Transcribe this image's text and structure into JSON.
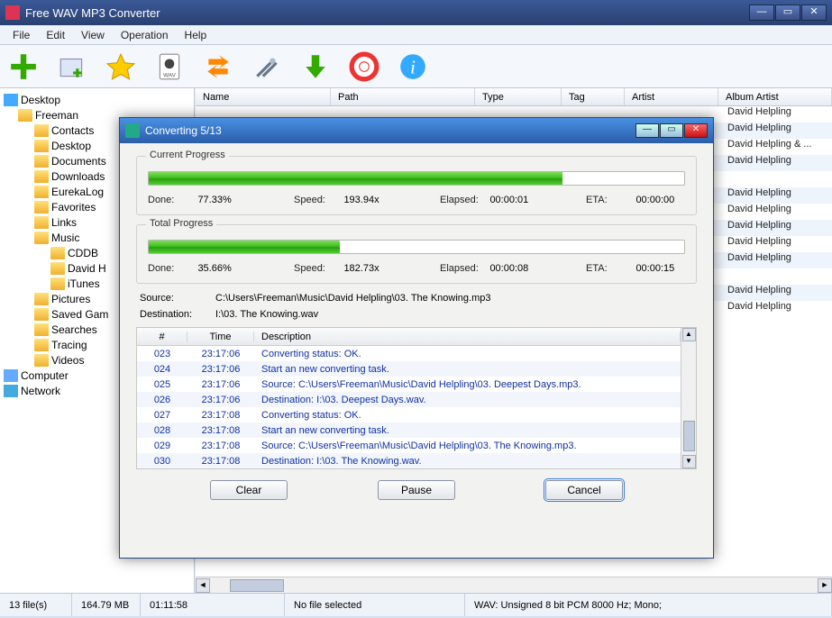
{
  "window": {
    "title": "Free WAV MP3 Converter",
    "menu": [
      "File",
      "Edit",
      "View",
      "Operation",
      "Help"
    ]
  },
  "toolbar_icons": [
    "add-file",
    "add-folder",
    "favorite",
    "output-format",
    "convert",
    "settings",
    "download",
    "help-life",
    "info"
  ],
  "tree": [
    {
      "label": "Desktop",
      "depth": 0,
      "icon": "monitor"
    },
    {
      "label": "Freeman",
      "depth": 1,
      "icon": "folder"
    },
    {
      "label": "Contacts",
      "depth": 2,
      "icon": "folder"
    },
    {
      "label": "Desktop",
      "depth": 2,
      "icon": "folder"
    },
    {
      "label": "Documents",
      "depth": 2,
      "icon": "folder"
    },
    {
      "label": "Downloads",
      "depth": 2,
      "icon": "folder"
    },
    {
      "label": "EurekaLog",
      "depth": 2,
      "icon": "folder"
    },
    {
      "label": "Favorites",
      "depth": 2,
      "icon": "folder"
    },
    {
      "label": "Links",
      "depth": 2,
      "icon": "folder"
    },
    {
      "label": "Music",
      "depth": 2,
      "icon": "folder"
    },
    {
      "label": "CDDB",
      "depth": 3,
      "icon": "folder"
    },
    {
      "label": "David H",
      "depth": 3,
      "icon": "folder"
    },
    {
      "label": "iTunes",
      "depth": 3,
      "icon": "folder"
    },
    {
      "label": "Pictures",
      "depth": 2,
      "icon": "folder"
    },
    {
      "label": "Saved Gam",
      "depth": 2,
      "icon": "folder"
    },
    {
      "label": "Searches",
      "depth": 2,
      "icon": "folder"
    },
    {
      "label": "Tracing",
      "depth": 2,
      "icon": "folder"
    },
    {
      "label": "Videos",
      "depth": 2,
      "icon": "folder"
    },
    {
      "label": "Computer",
      "depth": 0,
      "icon": "computer"
    },
    {
      "label": "Network",
      "depth": 0,
      "icon": "network"
    }
  ],
  "list": {
    "headers": [
      "Name",
      "Path",
      "Type",
      "Tag",
      "Artist",
      "Album Artist"
    ],
    "artist_rows": [
      "David Helpling",
      "David Helpling",
      "David Helpling & ...",
      "David Helpling",
      "",
      "David Helpling",
      "David Helpling",
      "David Helpling",
      "David Helpling",
      "David Helpling",
      "",
      "David Helpling",
      "David Helpling"
    ]
  },
  "status": {
    "files": "13 file(s)",
    "size": "164.79 MB",
    "dur": "01:11:58",
    "sel": "No file selected",
    "fmt": "WAV:   Unsigned 8 bit PCM  8000 Hz;  Mono;"
  },
  "dialog": {
    "title": "Converting 5/13",
    "current": {
      "label": "Current Progress",
      "pct": "77.33%",
      "pct_num": 77.33,
      "speed": "193.94x",
      "elapsed": "00:00:01",
      "eta": "00:00:00"
    },
    "total": {
      "label": "Total Progress",
      "pct": "35.66%",
      "pct_num": 35.66,
      "speed": "182.73x",
      "elapsed": "00:00:08",
      "eta": "00:00:15"
    },
    "labels": {
      "done": "Done:",
      "speed": "Speed:",
      "elapsed": "Elapsed:",
      "eta": "ETA:",
      "source": "Source:",
      "dest": "Destination:"
    },
    "source": "C:\\Users\\Freeman\\Music\\David Helpling\\03. The Knowing.mp3",
    "dest": "I:\\03. The Knowing.wav",
    "log": {
      "headers": [
        "#",
        "Time",
        "Description"
      ],
      "rows": [
        {
          "n": "023",
          "t": "23:17:06",
          "d": "Converting status: OK."
        },
        {
          "n": "024",
          "t": "23:17:06",
          "d": "Start an new converting task."
        },
        {
          "n": "025",
          "t": "23:17:06",
          "d": "Source:  C:\\Users\\Freeman\\Music\\David Helpling\\03. Deepest Days.mp3."
        },
        {
          "n": "026",
          "t": "23:17:06",
          "d": "Destination: I:\\03. Deepest Days.wav."
        },
        {
          "n": "027",
          "t": "23:17:08",
          "d": "Converting status: OK."
        },
        {
          "n": "028",
          "t": "23:17:08",
          "d": "Start an new converting task."
        },
        {
          "n": "029",
          "t": "23:17:08",
          "d": "Source:  C:\\Users\\Freeman\\Music\\David Helpling\\03. The Knowing.mp3."
        },
        {
          "n": "030",
          "t": "23:17:08",
          "d": "Destination: I:\\03. The Knowing.wav."
        }
      ]
    },
    "buttons": {
      "clear": "Clear",
      "pause": "Pause",
      "cancel": "Cancel"
    }
  }
}
